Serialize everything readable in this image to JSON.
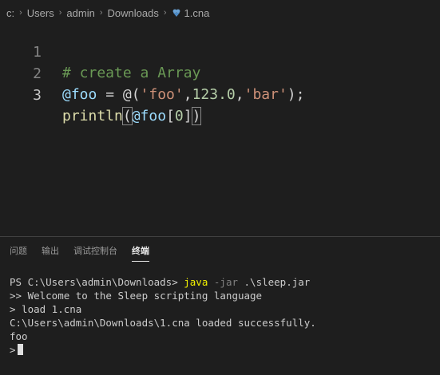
{
  "breadcrumb": {
    "items": [
      "c:",
      "Users",
      "admin",
      "Downloads",
      "1.cna"
    ]
  },
  "editor": {
    "lines": [
      {
        "number": "1",
        "tokens": [
          {
            "type": "comment",
            "text": "# create a Array"
          }
        ]
      },
      {
        "number": "2",
        "tokens": [
          {
            "type": "var",
            "text": "@foo"
          },
          {
            "type": "plain",
            "text": " = @("
          },
          {
            "type": "str",
            "text": "'foo'"
          },
          {
            "type": "plain",
            "text": ","
          },
          {
            "type": "num",
            "text": "123.0"
          },
          {
            "type": "plain",
            "text": ","
          },
          {
            "type": "str",
            "text": "'bar'"
          },
          {
            "type": "plain",
            "text": ");"
          }
        ]
      },
      {
        "number": "3",
        "tokens": [
          {
            "type": "func",
            "text": "println"
          },
          {
            "type": "plain",
            "text": "("
          },
          {
            "type": "var",
            "text": "@foo"
          },
          {
            "type": "plain",
            "text": "["
          },
          {
            "type": "num",
            "text": "0"
          },
          {
            "type": "plain",
            "text": "]"
          },
          {
            "type": "plain",
            "text": ")"
          }
        ]
      }
    ]
  },
  "panel": {
    "tabs": [
      {
        "label": "问题",
        "active": false
      },
      {
        "label": "输出",
        "active": false
      },
      {
        "label": "调试控制台",
        "active": false
      },
      {
        "label": "终端",
        "active": true
      }
    ]
  },
  "terminal": {
    "prompt": "PS C:\\Users\\admin\\Downloads>",
    "command": "java",
    "option": "-jar",
    "argument": ".\\sleep.jar",
    "output": [
      ">> Welcome to the Sleep scripting language",
      "> load 1.cna",
      "C:\\Users\\admin\\Downloads\\1.cna loaded successfully.",
      "foo"
    ],
    "input_prompt": ">"
  },
  "colors": {
    "background": "#1e1e1e",
    "comment": "#6a9955",
    "variable": "#9cdcfe",
    "string": "#ce9178",
    "number": "#b5cea8",
    "function": "#dcdcaa",
    "terminal_command": "#f2f200"
  }
}
